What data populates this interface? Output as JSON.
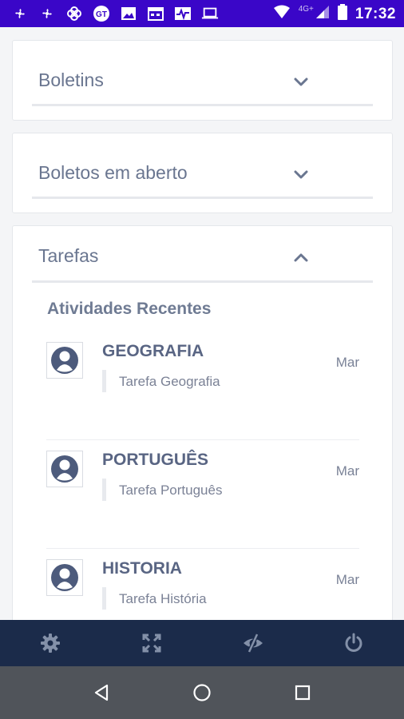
{
  "status_bar": {
    "time": "17:32",
    "network": "4G+",
    "icons": [
      "fan-icon",
      "fan-icon",
      "pinwheel-icon",
      "gt-app-icon",
      "image-icon",
      "calendar-icon",
      "pulse-icon",
      "laptop-icon",
      "wifi-icon",
      "signal-icon",
      "battery-icon"
    ]
  },
  "cards": {
    "boletins": {
      "title": "Boletins",
      "state": "collapsed"
    },
    "boletos": {
      "title": "Boletos em aberto",
      "state": "collapsed"
    },
    "tarefas": {
      "title": "Tarefas",
      "state": "expanded"
    }
  },
  "tarefas": {
    "section_title": "Atividades Recentes",
    "activities": [
      {
        "subject": "GEOGRAFIA",
        "task": "Tarefa Geografia",
        "month": "Mar"
      },
      {
        "subject": "PORTUGUÊS",
        "task": "Tarefa Português",
        "month": "Mar"
      },
      {
        "subject": "HISTORIA",
        "task": "Tarefa História",
        "month": "Mar"
      }
    ]
  },
  "toolbar": {
    "icons": [
      "gear-icon",
      "expand-icon",
      "eye-slash-icon",
      "power-icon"
    ],
    "color": "#1b2b4a",
    "icon_color": "#8390a8"
  },
  "android_nav": {
    "icons": [
      "back-icon",
      "home-icon",
      "recents-icon"
    ]
  },
  "colors": {
    "status_bar": "#3a06c8",
    "text_primary": "#596583",
    "text_secondary": "#7b8296"
  }
}
